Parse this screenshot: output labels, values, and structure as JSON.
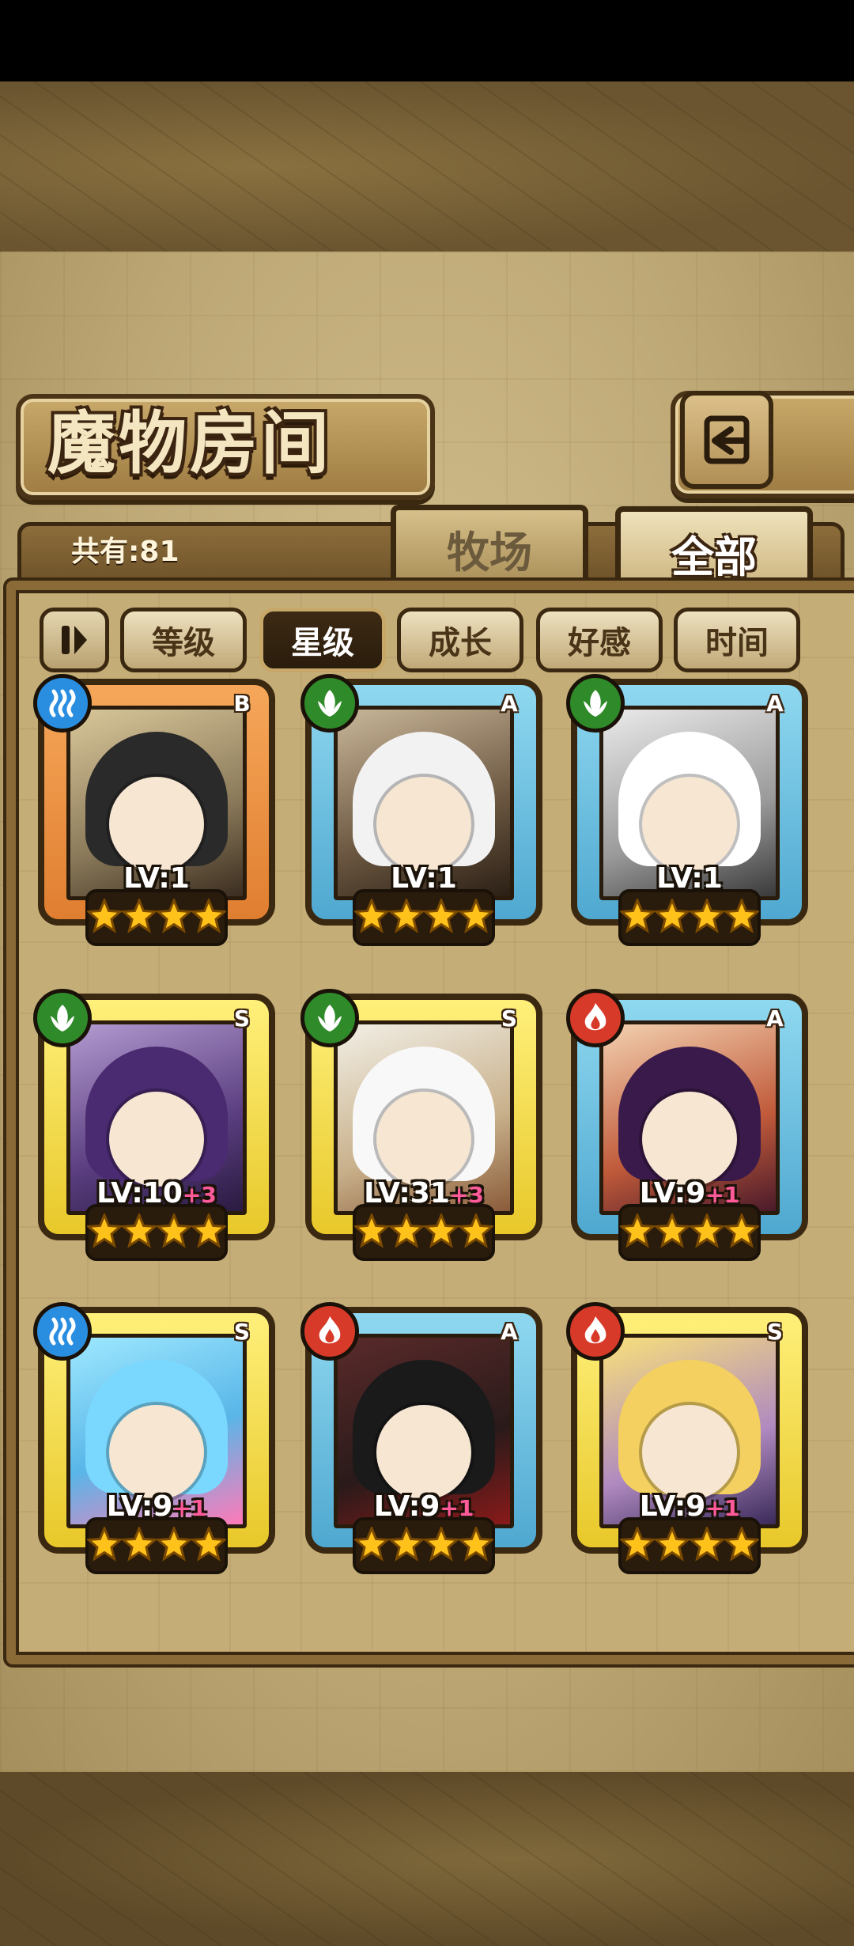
{
  "screen": {
    "title": "魔物房间",
    "total_label": "共有:81"
  },
  "tabs": [
    {
      "label": "牧场",
      "active": false
    },
    {
      "label": "全部",
      "active": true
    }
  ],
  "sort_buttons": [
    {
      "label": "等级",
      "active": false
    },
    {
      "label": "星级",
      "active": true
    },
    {
      "label": "成长",
      "active": false
    },
    {
      "label": "好感",
      "active": false
    },
    {
      "label": "时间",
      "active": false
    }
  ],
  "monsters": [
    {
      "rank": "B",
      "element": "water",
      "level": "LV:1",
      "bonus": "",
      "stars": 4,
      "frame": "orange"
    },
    {
      "rank": "A",
      "element": "wood",
      "level": "LV:1",
      "bonus": "",
      "stars": 4,
      "frame": "blue"
    },
    {
      "rank": "A",
      "element": "wood",
      "level": "LV:1",
      "bonus": "",
      "stars": 4,
      "frame": "blue"
    },
    {
      "rank": "S",
      "element": "wood",
      "level": "LV:10",
      "bonus": "+3",
      "stars": 4,
      "frame": "gold"
    },
    {
      "rank": "S",
      "element": "wood",
      "level": "LV:31",
      "bonus": "+3",
      "stars": 4,
      "frame": "gold"
    },
    {
      "rank": "A",
      "element": "fire",
      "level": "LV:9",
      "bonus": "+1",
      "stars": 4,
      "frame": "blue"
    },
    {
      "rank": "S",
      "element": "water",
      "level": "LV:9",
      "bonus": "+1",
      "stars": 4,
      "frame": "gold"
    },
    {
      "rank": "A",
      "element": "fire",
      "level": "LV:9",
      "bonus": "+1",
      "stars": 4,
      "frame": "blue"
    },
    {
      "rank": "S",
      "element": "fire",
      "level": "LV:9",
      "bonus": "+1",
      "stars": 4,
      "frame": "gold"
    }
  ],
  "colors": {
    "water": "#2a8ee0",
    "wood": "#2f8a2a",
    "fire": "#d83a2a",
    "star": "#ffc21a"
  },
  "icons": {
    "back": "return-arrow-icon",
    "filter": "filter-toggle-icon"
  }
}
